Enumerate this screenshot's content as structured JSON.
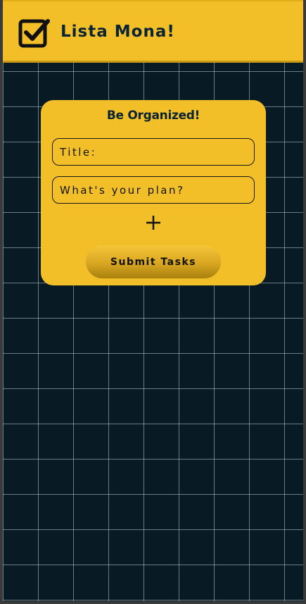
{
  "header": {
    "logo_icon": "checkbox-checked-icon",
    "title": "Lista Mona!"
  },
  "form": {
    "heading": "Be Organized!",
    "title_placeholder": "Title:",
    "plan_placeholder": "What's your plan?",
    "add_icon": "plus-icon",
    "submit_label": "Submit Tasks"
  },
  "colors": {
    "accent": "#f3bf28",
    "background": "#081a24",
    "text_dark": "#0b2433"
  }
}
